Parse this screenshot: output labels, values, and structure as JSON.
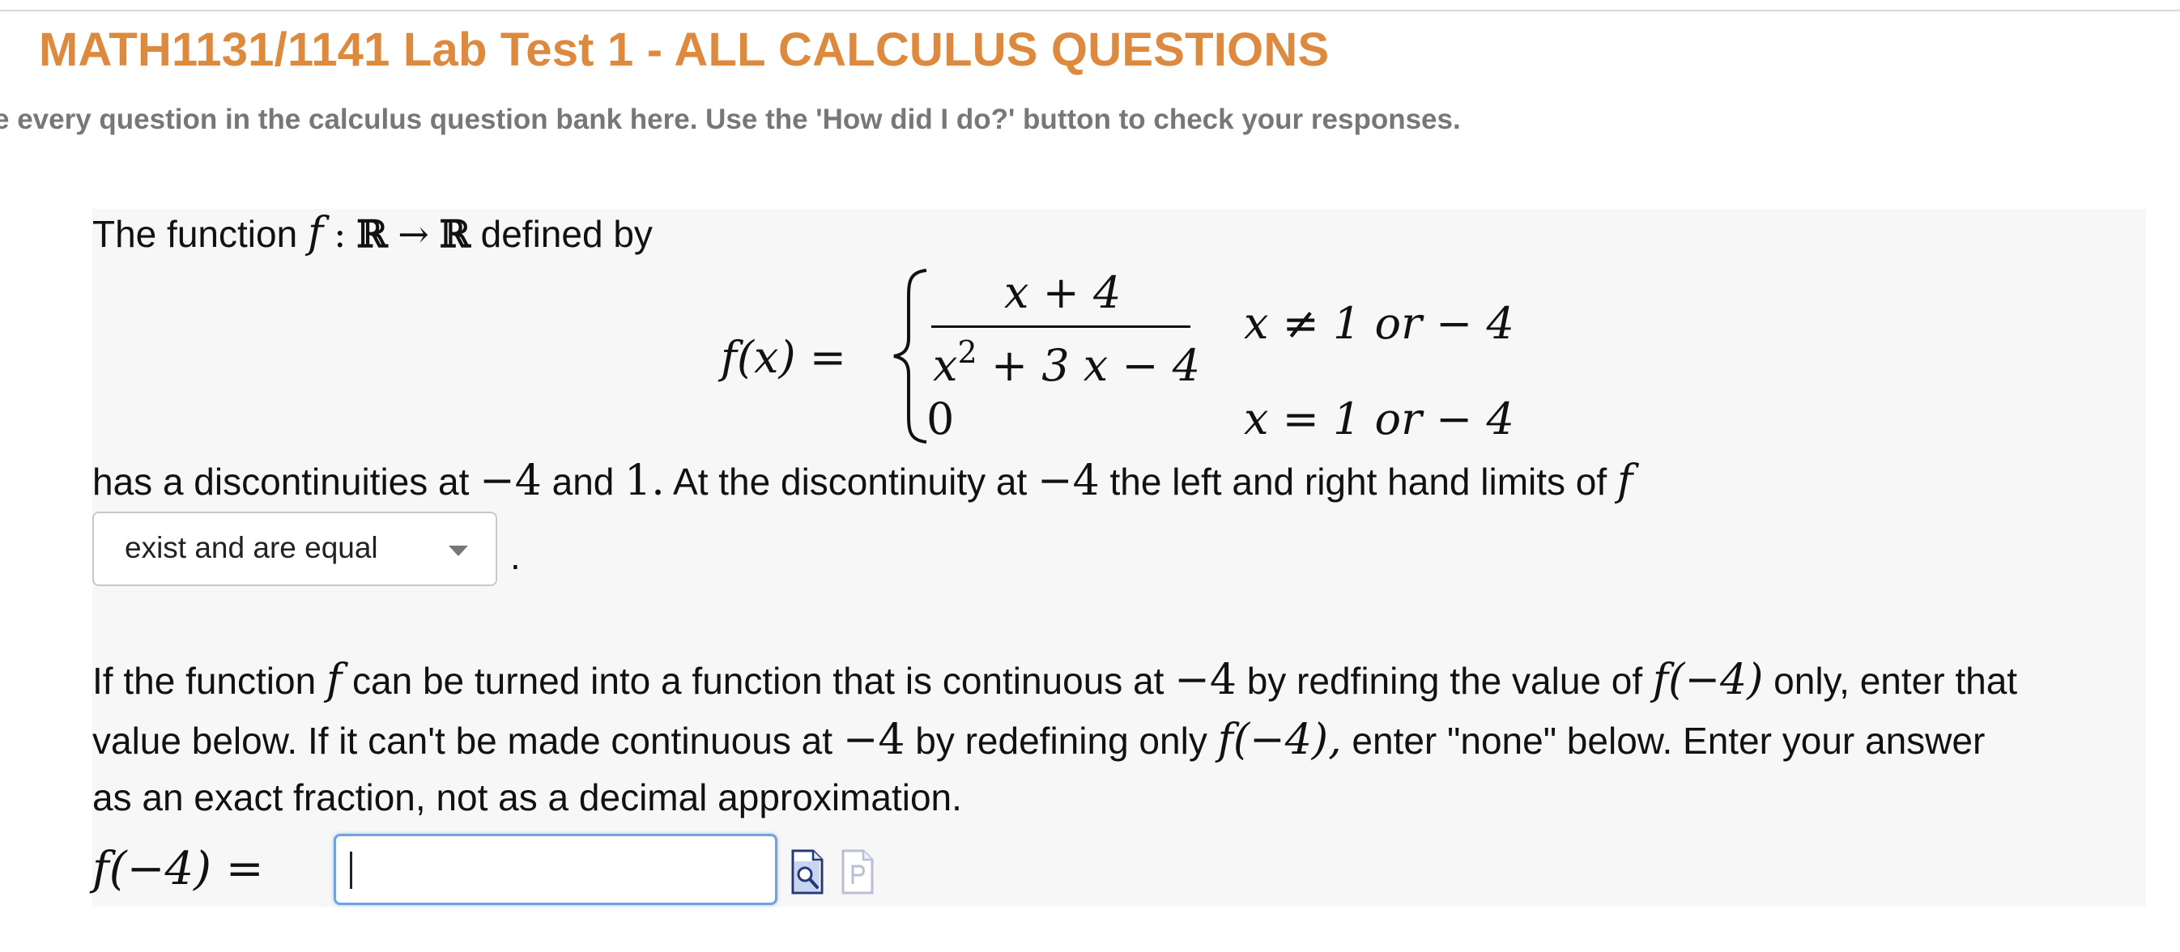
{
  "header": {
    "title": "MATH1131/1141 Lab Test 1 - ALL CALCULUS QUESTIONS",
    "subtitle": "e every question in the calculus question bank here. Use the 'How did I do?' button to check your responses."
  },
  "question": {
    "intro_text": "The function",
    "intro_f": "f",
    "intro_colon": ":",
    "intro_R1": "ℝ",
    "intro_arrow": "→",
    "intro_R2": "ℝ",
    "intro_defined": "defined by",
    "piecewise": {
      "lhs": "f(x) =",
      "numerator": "x + 4",
      "denominator_base": "x",
      "denominator_exp": "2",
      "denominator_rest": "+ 3 x − 4",
      "case1_condition": "x ≠ 1 or  − 4",
      "case2_value": "0",
      "case2_condition": "x = 1 or  − 4"
    },
    "line2": {
      "a": "has a discontinuities at",
      "v1": "−4",
      "b": "and",
      "v2": "1.",
      "c": "At the discontinuity at",
      "v3": "−4",
      "d": "the left and right hand limits of",
      "f": "f"
    },
    "dropdown": {
      "selected": "exist and are equal"
    },
    "period": ".",
    "para": {
      "l1_a": "If the function",
      "l1_f": "f",
      "l1_b": "can be turned into a function that is continuous at",
      "l1_v": "−4",
      "l1_c": "by redfining the value of",
      "l1_fv": "f(−4)",
      "l1_d": "only, enter that",
      "l2_a": "value below.  If it can't be made continuous at",
      "l2_v": "−4",
      "l2_b": "by redefining only",
      "l2_fv": "f(−4),",
      "l2_c": "enter \"none\" below.  Enter your answer",
      "l3": "as an exact fraction, not as a decimal approximation."
    },
    "answer": {
      "label": "f(−4) =",
      "value": ""
    }
  },
  "icons": {
    "preview": "preview-icon",
    "syntax": "syntax-help-icon"
  },
  "colors": {
    "title": "#dd8a3e",
    "subtitle": "#777777",
    "panel": "#f7f7f7",
    "input_focus": "#6ea3e0"
  }
}
